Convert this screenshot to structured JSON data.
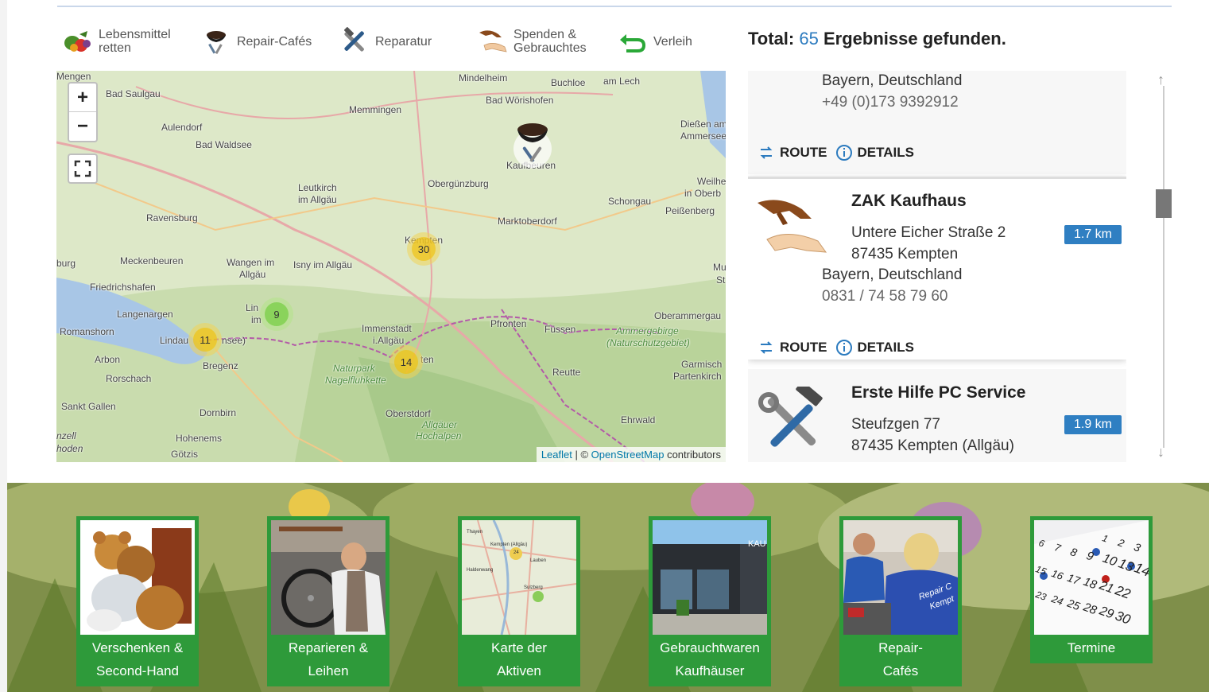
{
  "categories": [
    {
      "label": "Lebensmittel\nretten",
      "icon": "vegetables-icon"
    },
    {
      "label": "Repair-Cafés",
      "icon": "coffee-tools-icon"
    },
    {
      "label": "Reparatur",
      "icon": "tools-icon"
    },
    {
      "label": "Spenden &\nGebrauchtes",
      "icon": "hands-icon"
    },
    {
      "label": "Verleih",
      "icon": "return-arrow-icon"
    }
  ],
  "total": {
    "prefix": "Total:",
    "count": "65",
    "suffix": "Ergebnisse gefunden."
  },
  "map": {
    "zoom_in": "+",
    "zoom_out": "−",
    "clusters": [
      {
        "count": "30",
        "color": "yellow"
      },
      {
        "count": "11",
        "color": "yellow"
      },
      {
        "count": "14",
        "color": "yellow"
      },
      {
        "count": "9",
        "color": "green"
      }
    ],
    "places": [
      "Mengen",
      "Bad Saulgau",
      "Aulendorf",
      "Bad Waldsee",
      "Mindelheim",
      "Buchloe",
      "am Lech",
      "Bad Wörishofen",
      "Memmingen",
      "Dießen am",
      "Ammersee",
      "Leutkirch",
      "im Allgäu",
      "Obergünzburg",
      "Ravensburg",
      "Marktoberdorf",
      "Schongau",
      "Peißenberg",
      "Weilheim",
      "in Oberb",
      "burg",
      "Meckenbeuren",
      "Wangen im",
      "Allgäu",
      "Isny im Allgäu",
      "Friedrichshafen",
      "Langenargen",
      "Romanshorn",
      "Lindau",
      "Bregenz",
      "Arbon",
      "Rorschach",
      "Immenstadt",
      "i.Allgäu",
      "Pfronten",
      "Füssen",
      "Oberammergau",
      "Reutte",
      "Garmisch",
      "Partenkirch",
      "Sankt Gallen",
      "Dornbirn",
      "Oberstdorf",
      "Ehrwald",
      "Hohenems",
      "Götzis",
      "nzell",
      "hoden",
      "Kaufbeuren",
      "Kempten",
      "Mu",
      "St",
      "Lin",
      "im",
      "nsee)",
      "ten"
    ],
    "parks": [
      "Naturpark",
      "Nagelfluhkette",
      "Ammergebirge",
      "(Naturschutzgebiet)",
      "Allgäuer",
      "Hochalpen"
    ],
    "attribution_leaflet": "Leaflet",
    "attribution_sep": " | © ",
    "attribution_osm": "OpenStreetMap",
    "attribution_tail": " contributors"
  },
  "results": [
    {
      "region": "Bayern, Deutschland",
      "phone": "+49 (0)173 9392912",
      "route": "ROUTE",
      "details": "DETAILS"
    },
    {
      "name": "ZAK Kaufhaus",
      "street": "Untere Eicher Straße 2",
      "city": "87435 Kempten",
      "region": "Bayern, Deutschland",
      "phone": "0831 / 74 58 79 60",
      "distance": "1.7 km",
      "route": "ROUTE",
      "details": "DETAILS"
    },
    {
      "name": "Erste Hilfe PC Service",
      "street": "Steufzgen 77",
      "city": "87435 Kempten (Allgäu)",
      "distance": "1.9 km"
    }
  ],
  "tiles": [
    {
      "label1": "Verschenken &",
      "label2": "Second-Hand"
    },
    {
      "label1": "Reparieren &",
      "label2": "Leihen"
    },
    {
      "label1": "Karte der",
      "label2": "Aktiven"
    },
    {
      "label1": "Gebrauchtwaren",
      "label2": "Kaufhäuser"
    },
    {
      "label1": "Repair-",
      "label2": "Cafés"
    },
    {
      "label1": "Termine",
      "label2": ""
    }
  ],
  "tile_images": {
    "map_thumb_places": [
      "Thayen",
      "Kempten (Allgäu)",
      "Lauben",
      "Haldenwang",
      "Sulzberg"
    ],
    "map_thumb_count": "24",
    "store_sign": "KAU",
    "repair_shirt": "Repair C",
    "repair_shirt2": "Kempt",
    "calendar_numbers": [
      "1",
      "2",
      "3",
      "6",
      "7",
      "8",
      "9",
      "10",
      "13",
      "14",
      "15",
      "16",
      "17",
      "18",
      "21",
      "22",
      "23",
      "24",
      "25",
      "28",
      "29",
      "30"
    ]
  },
  "colors": {
    "accent": "#2c7bbf",
    "tile_green": "#2e9a3a",
    "badge": "#2f7fc2"
  }
}
